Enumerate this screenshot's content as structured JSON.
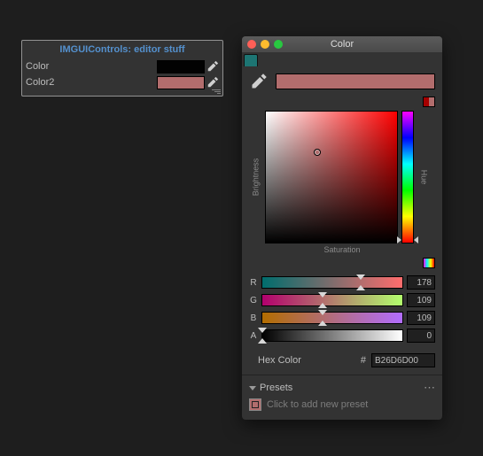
{
  "inspector": {
    "title": "IMGUIControls: editor stuff",
    "rows": [
      {
        "label": "Color",
        "swatch_color": "#020202"
      },
      {
        "label": "Color2",
        "swatch_color": "#b26d6d"
      }
    ]
  },
  "picker": {
    "window_title": "Color",
    "traffic": {
      "close": "#ff5f57",
      "min": "#febc2e",
      "max": "#28c840"
    },
    "current_color": "#b26d6d",
    "compare": {
      "old": "#a60000",
      "new": "#b26d6d"
    },
    "axes": {
      "brightness": "Brightness",
      "saturation": "Saturation",
      "hue": "Hue"
    },
    "sv_cursor": {
      "x_pct": 39,
      "y_pct": 31
    },
    "hue_thumb_pct": 98,
    "channels": {
      "R": {
        "label": "R",
        "value": "178",
        "pct": 70
      },
      "G": {
        "label": "G",
        "value": "109",
        "pct": 43
      },
      "B": {
        "label": "B",
        "value": "109",
        "pct": 43
      },
      "A": {
        "label": "A",
        "value": "0",
        "pct": 0
      }
    },
    "hex_label": "Hex Color",
    "hex_hash": "#",
    "hex_value": "B26D6D00",
    "presets": {
      "header": "Presets",
      "hint": "Click to add new preset"
    }
  }
}
